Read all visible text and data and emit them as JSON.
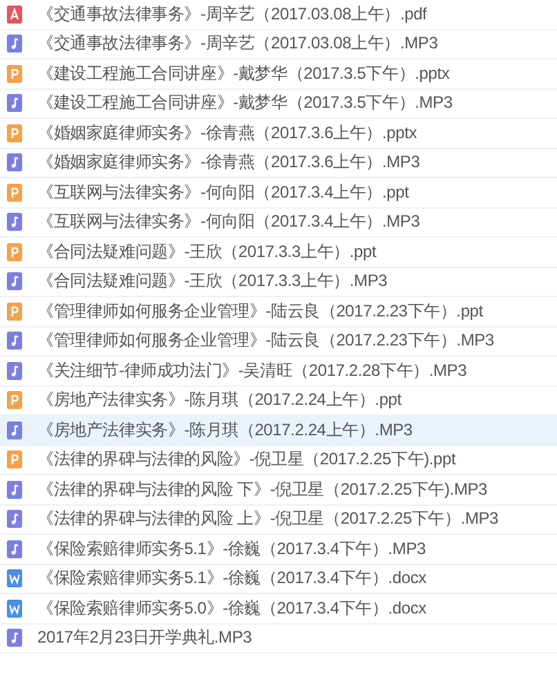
{
  "files": [
    {
      "kind": "pdf",
      "name": "《交通事故法律事务》-周辛艺（2017.03.08上午）.pdf",
      "highlighted": false
    },
    {
      "kind": "audio",
      "name": "《交通事故法律事务》-周辛艺（2017.03.08上午）.MP3",
      "highlighted": false
    },
    {
      "kind": "slides",
      "name": "《建设工程施工合同讲座》-戴梦华（2017.3.5下午）.pptx",
      "highlighted": false
    },
    {
      "kind": "audio",
      "name": "《建设工程施工合同讲座》-戴梦华（2017.3.5下午）.MP3",
      "highlighted": false
    },
    {
      "kind": "slides",
      "name": "《婚姻家庭律师实务》-徐青燕（2017.3.6上午）.pptx",
      "highlighted": false
    },
    {
      "kind": "audio",
      "name": "《婚姻家庭律师实务》-徐青燕（2017.3.6上午）.MP3",
      "highlighted": false
    },
    {
      "kind": "slides",
      "name": "《互联网与法律实务》-何向阳（2017.3.4上午）.ppt",
      "highlighted": false
    },
    {
      "kind": "audio",
      "name": "《互联网与法律实务》-何向阳（2017.3.4上午）.MP3",
      "highlighted": false
    },
    {
      "kind": "slides",
      "name": "《合同法疑难问题》-王欣（2017.3.3上午）.ppt",
      "highlighted": false
    },
    {
      "kind": "audio",
      "name": "《合同法疑难问题》-王欣（2017.3.3上午）.MP3",
      "highlighted": false
    },
    {
      "kind": "slides",
      "name": "《管理律师如何服务企业管理》-陆云良（2017.2.23下午）.ppt",
      "highlighted": false
    },
    {
      "kind": "audio",
      "name": "《管理律师如何服务企业管理》-陆云良（2017.2.23下午）.MP3",
      "highlighted": false
    },
    {
      "kind": "audio",
      "name": "《关注细节-律师成功法门》-吴清旺（2017.2.28下午）.MP3",
      "highlighted": false
    },
    {
      "kind": "slides",
      "name": "《房地产法律实务》-陈月琪（2017.2.24上午）.ppt",
      "highlighted": false
    },
    {
      "kind": "audio",
      "name": "《房地产法律实务》-陈月琪（2017.2.24上午）.MP3",
      "highlighted": true
    },
    {
      "kind": "slides",
      "name": "《法律的界碑与法律的风险》-倪卫星（2017.2.25下午).ppt",
      "highlighted": false
    },
    {
      "kind": "audio",
      "name": "《法律的界碑与法律的风险 下》-倪卫星（2017.2.25下午).MP3",
      "highlighted": false
    },
    {
      "kind": "audio",
      "name": "《法律的界碑与法律的风险 上》-倪卫星（2017.2.25下午）.MP3",
      "highlighted": false
    },
    {
      "kind": "audio",
      "name": "《保险索赔律师实务5.1》-徐巍（2017.3.4下午）.MP3",
      "highlighted": false
    },
    {
      "kind": "doc",
      "name": "《保险索赔律师实务5.1》-徐巍（2017.3.4下午）.docx",
      "highlighted": false
    },
    {
      "kind": "doc",
      "name": "《保险索赔律师实务5.0》-徐巍（2017.3.4下午）.docx",
      "highlighted": false
    },
    {
      "kind": "audio",
      "name": "2017年2月23日开学典礼.MP3",
      "highlighted": false
    }
  ]
}
